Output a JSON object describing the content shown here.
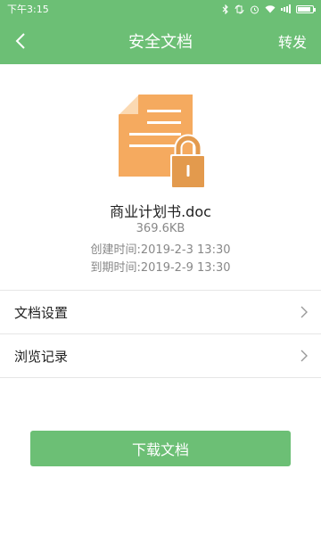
{
  "status_bar": {
    "time": "下午3:15",
    "icons": [
      "bluetooth-icon",
      "rotation-icon",
      "alarm-icon",
      "wifi-icon",
      "signal-icon",
      "battery-icon"
    ],
    "battery_level": 0.9
  },
  "header": {
    "back_icon": "chevron-left-icon",
    "title": "安全文档",
    "action_label": "转发"
  },
  "file": {
    "icon": "locked-document-icon",
    "name": "商业计划书.doc",
    "size": "369.6KB",
    "created_label": "创建时间:",
    "created_value": "2019-2-3 13:30",
    "expires_label": "到期时间:",
    "expires_value": "2019-2-9 13:30"
  },
  "menu": {
    "items": [
      {
        "label": "文档设置",
        "icon": "chevron-right-icon"
      },
      {
        "label": "浏览记录",
        "icon": "chevron-right-icon"
      }
    ]
  },
  "download_button": {
    "label": "下载文档"
  },
  "colors": {
    "accent": "#6cbf75",
    "document": "#f5aa5f",
    "lock": "#e39a4d"
  }
}
